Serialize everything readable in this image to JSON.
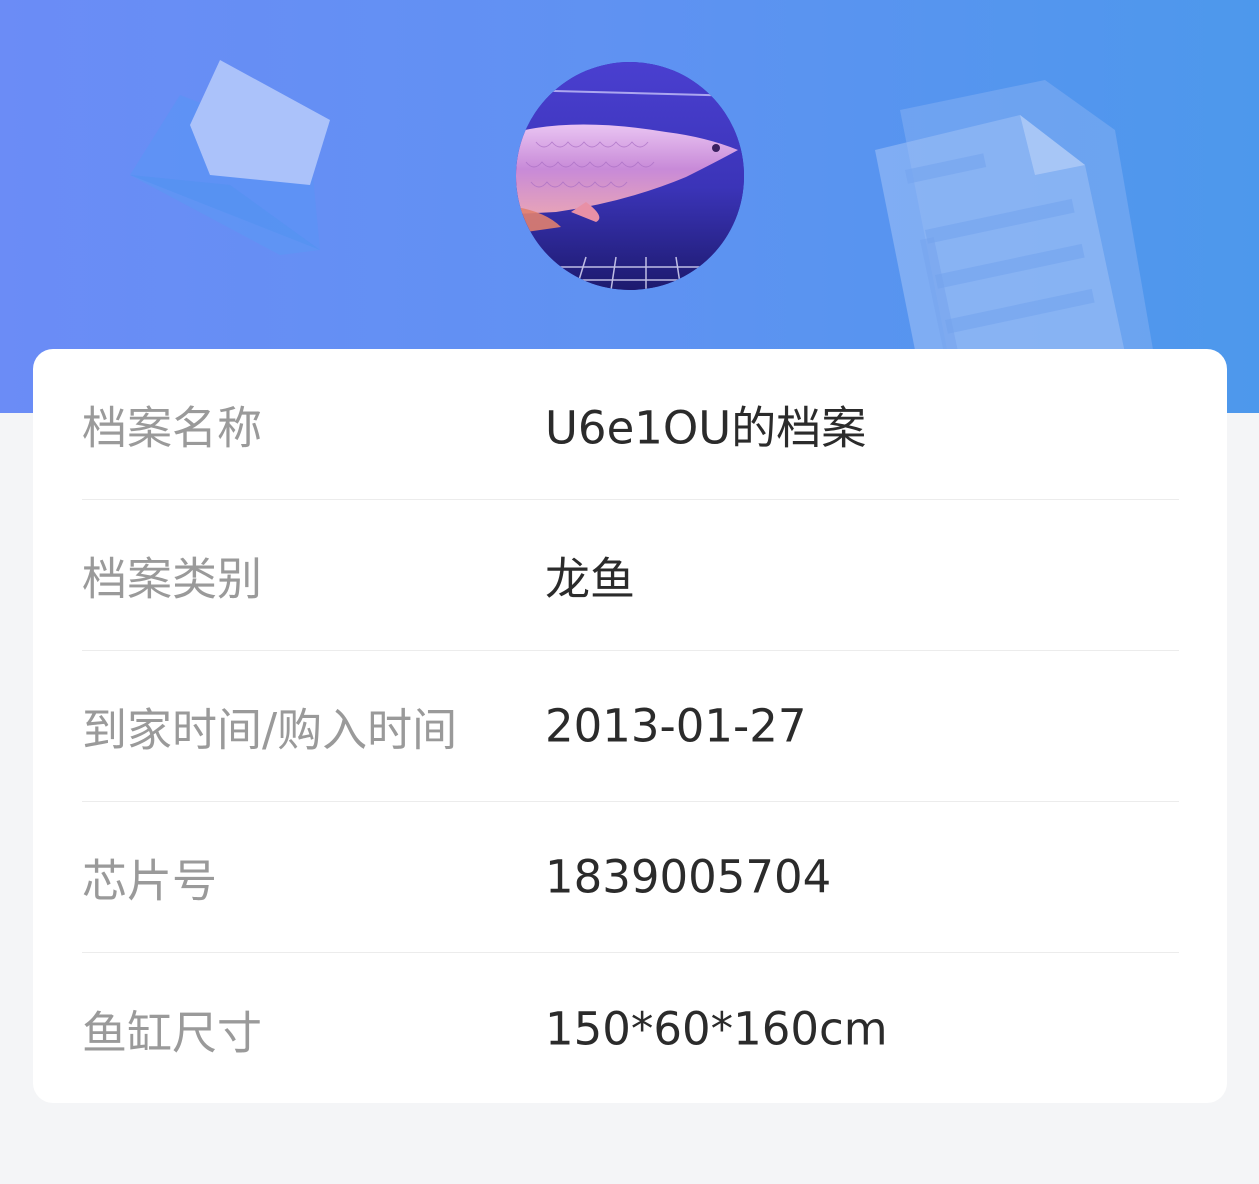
{
  "colors": {
    "header_start": "#6b8cf6",
    "header_end": "#4d98ec",
    "label": "#9a9a9a",
    "value": "#2b2b2b",
    "card": "#ffffff",
    "background": "#f4f5f7"
  },
  "header": {
    "avatar_icon": "arowana-fish-photo",
    "left_decoration_icon": "envelope-icon",
    "right_decoration_icon": "document-icon"
  },
  "profile": {
    "rows": [
      {
        "label": "档案名称",
        "value": "U6e1OU的档案"
      },
      {
        "label": "档案类别",
        "value": "龙鱼"
      },
      {
        "label": "到家时间/购入时间",
        "value": "2013-01-27"
      },
      {
        "label": "芯片号",
        "value": "1839005704"
      },
      {
        "label": "鱼缸尺寸",
        "value": "150*60*160cm"
      }
    ]
  }
}
